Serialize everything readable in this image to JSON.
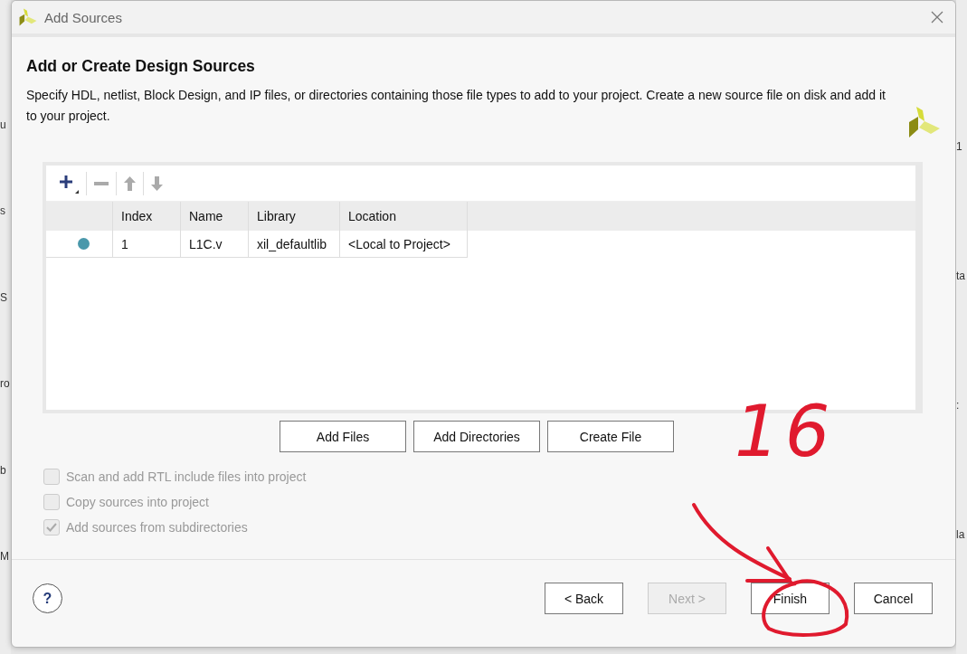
{
  "background_app": {
    "left_fragments": [
      "u",
      "s",
      "S",
      "ro",
      "b",
      "M"
    ],
    "right_fragments": [
      "1",
      "ta",
      ":",
      "la"
    ]
  },
  "window": {
    "title": "Add Sources"
  },
  "header": {
    "title": "Add or Create Design Sources",
    "description": "Specify HDL, netlist, Block Design, and IP files, or directories containing those file types to add to your project. Create a new source file on disk and add it to your project."
  },
  "toolbar": [
    {
      "kind": "add",
      "disabled": false
    },
    {
      "kind": "remove",
      "disabled": true
    },
    {
      "kind": "up",
      "disabled": true
    },
    {
      "kind": "down",
      "disabled": true
    }
  ],
  "table": {
    "columns": [
      "Index",
      "Name",
      "Library",
      "Location"
    ],
    "rows": [
      {
        "color": "#4a98ab",
        "cells": [
          "1",
          "L1C.v",
          "xil_defaultlib",
          "<Local to Project>"
        ]
      }
    ]
  },
  "actions": [
    "Add Files",
    "Add Directories",
    "Create File"
  ],
  "options": [
    {
      "label": "Scan and add RTL include files into project",
      "checked": false,
      "disabled": true
    },
    {
      "label": "Copy sources into project",
      "checked": false,
      "disabled": true
    },
    {
      "label": "Add sources from subdirectories",
      "checked": true,
      "disabled": true
    }
  ],
  "footer": {
    "help": "?",
    "buttons": [
      {
        "label": "< Back",
        "disabled": false
      },
      {
        "label": "Next >",
        "disabled": true
      },
      {
        "label": "Finish",
        "disabled": false
      },
      {
        "label": "Cancel",
        "disabled": false
      }
    ]
  },
  "annotation": {
    "text": "16",
    "color": "#e01a2e"
  }
}
